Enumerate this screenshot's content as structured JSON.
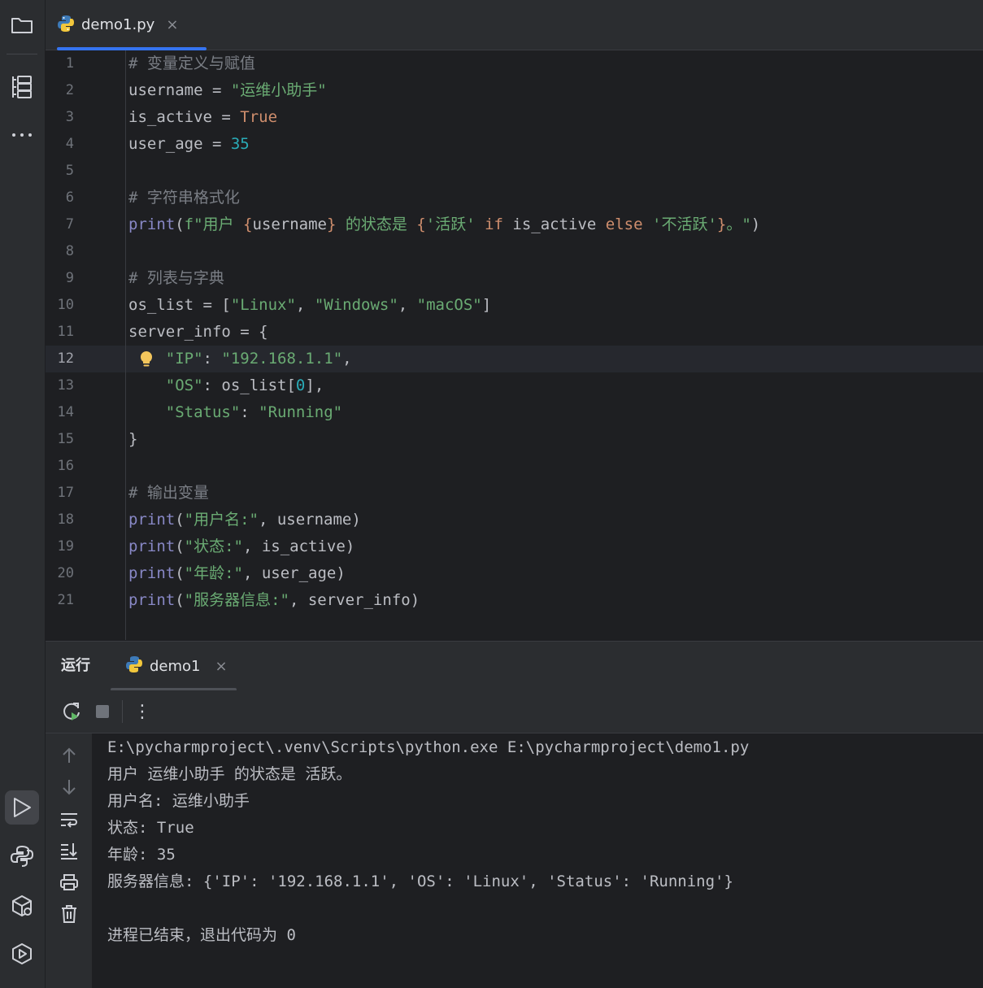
{
  "sidebar": {
    "icons": [
      "folder-icon",
      "structure-icon",
      "more-icon",
      "run-icon",
      "python-console-icon",
      "python-packages-icon",
      "services-icon"
    ]
  },
  "editor_tab": {
    "filename": "demo1.py",
    "close": "×"
  },
  "editor": {
    "current_line": 12,
    "lines": [
      {
        "n": "1",
        "tokens": [
          {
            "t": "# 变量定义与赋值",
            "c": "com"
          }
        ]
      },
      {
        "n": "2",
        "tokens": [
          {
            "t": "username = ",
            "c": ""
          },
          {
            "t": "\"运维小助手\"",
            "c": "str"
          }
        ]
      },
      {
        "n": "3",
        "tokens": [
          {
            "t": "is_active = ",
            "c": ""
          },
          {
            "t": "True",
            "c": "kw"
          }
        ]
      },
      {
        "n": "4",
        "tokens": [
          {
            "t": "user_age = ",
            "c": ""
          },
          {
            "t": "35",
            "c": "num"
          }
        ]
      },
      {
        "n": "5",
        "tokens": []
      },
      {
        "n": "6",
        "tokens": [
          {
            "t": "# 字符串格式化",
            "c": "com"
          }
        ]
      },
      {
        "n": "7",
        "tokens": [
          {
            "t": "print",
            "c": "fn"
          },
          {
            "t": "(",
            "c": ""
          },
          {
            "t": "f\"用户 ",
            "c": "str"
          },
          {
            "t": "{",
            "c": "fb"
          },
          {
            "t": "username",
            "c": ""
          },
          {
            "t": "}",
            "c": "fb"
          },
          {
            "t": " 的状态是 ",
            "c": "str"
          },
          {
            "t": "{",
            "c": "fb"
          },
          {
            "t": "'活跃'",
            "c": "str"
          },
          {
            "t": " if ",
            "c": "kw"
          },
          {
            "t": "is_active",
            "c": ""
          },
          {
            "t": " else ",
            "c": "kw"
          },
          {
            "t": "'不活跃'",
            "c": "str"
          },
          {
            "t": "}",
            "c": "fb"
          },
          {
            "t": "。\"",
            "c": "str"
          },
          {
            "t": ")",
            "c": ""
          }
        ]
      },
      {
        "n": "8",
        "tokens": []
      },
      {
        "n": "9",
        "tokens": [
          {
            "t": "# 列表与字典",
            "c": "com"
          }
        ]
      },
      {
        "n": "10",
        "tokens": [
          {
            "t": "os_list = [",
            "c": ""
          },
          {
            "t": "\"Linux\"",
            "c": "str"
          },
          {
            "t": ", ",
            "c": ""
          },
          {
            "t": "\"Windows\"",
            "c": "str"
          },
          {
            "t": ", ",
            "c": ""
          },
          {
            "t": "\"macOS\"",
            "c": "str"
          },
          {
            "t": "]",
            "c": ""
          }
        ]
      },
      {
        "n": "11",
        "tokens": [
          {
            "t": "server_info = {",
            "c": ""
          }
        ]
      },
      {
        "n": "12",
        "tokens": [
          {
            "t": "    ",
            "c": ""
          },
          {
            "t": "\"IP\"",
            "c": "str"
          },
          {
            "t": ": ",
            "c": ""
          },
          {
            "t": "\"192.168.1.1\"",
            "c": "str"
          },
          {
            "t": ",",
            "c": ""
          }
        ]
      },
      {
        "n": "13",
        "tokens": [
          {
            "t": "    ",
            "c": ""
          },
          {
            "t": "\"OS\"",
            "c": "str"
          },
          {
            "t": ": os_list[",
            "c": ""
          },
          {
            "t": "0",
            "c": "num"
          },
          {
            "t": "],",
            "c": ""
          }
        ]
      },
      {
        "n": "14",
        "tokens": [
          {
            "t": "    ",
            "c": ""
          },
          {
            "t": "\"Status\"",
            "c": "str"
          },
          {
            "t": ": ",
            "c": ""
          },
          {
            "t": "\"Running\"",
            "c": "str"
          }
        ]
      },
      {
        "n": "15",
        "tokens": [
          {
            "t": "}",
            "c": ""
          }
        ]
      },
      {
        "n": "16",
        "tokens": []
      },
      {
        "n": "17",
        "tokens": [
          {
            "t": "# 输出变量",
            "c": "com"
          }
        ]
      },
      {
        "n": "18",
        "tokens": [
          {
            "t": "print",
            "c": "fn"
          },
          {
            "t": "(",
            "c": ""
          },
          {
            "t": "\"用户名:\"",
            "c": "str"
          },
          {
            "t": ", username)",
            "c": ""
          }
        ]
      },
      {
        "n": "19",
        "tokens": [
          {
            "t": "print",
            "c": "fn"
          },
          {
            "t": "(",
            "c": ""
          },
          {
            "t": "\"状态:\"",
            "c": "str"
          },
          {
            "t": ", is_active)",
            "c": ""
          }
        ]
      },
      {
        "n": "20",
        "tokens": [
          {
            "t": "print",
            "c": "fn"
          },
          {
            "t": "(",
            "c": ""
          },
          {
            "t": "\"年龄:\"",
            "c": "str"
          },
          {
            "t": ", user_age)",
            "c": ""
          }
        ]
      },
      {
        "n": "21",
        "tokens": [
          {
            "t": "print",
            "c": "fn"
          },
          {
            "t": "(",
            "c": ""
          },
          {
            "t": "\"服务器信息:\"",
            "c": "str"
          },
          {
            "t": ", server_info)",
            "c": ""
          }
        ]
      }
    ]
  },
  "run_panel": {
    "title": "运行",
    "tab_label": "demo1",
    "tab_close": "×",
    "more_glyph": "⋮",
    "console_lines": [
      "E:\\pycharmproject\\.venv\\Scripts\\python.exe E:\\pycharmproject\\demo1.py",
      "用户 运维小助手 的状态是 活跃。",
      "用户名: 运维小助手",
      "状态: True",
      "年龄: 35",
      "服务器信息: {'IP': '192.168.1.1', 'OS': 'Linux', 'Status': 'Running'}",
      "",
      "进程已结束，退出代码为 0"
    ]
  },
  "colors": {
    "accent": "#3574f0",
    "comment": "#7a7e85",
    "string": "#6aab73",
    "keyword": "#cf8e6d",
    "number": "#2aacb8",
    "builtin": "#8888c6"
  }
}
